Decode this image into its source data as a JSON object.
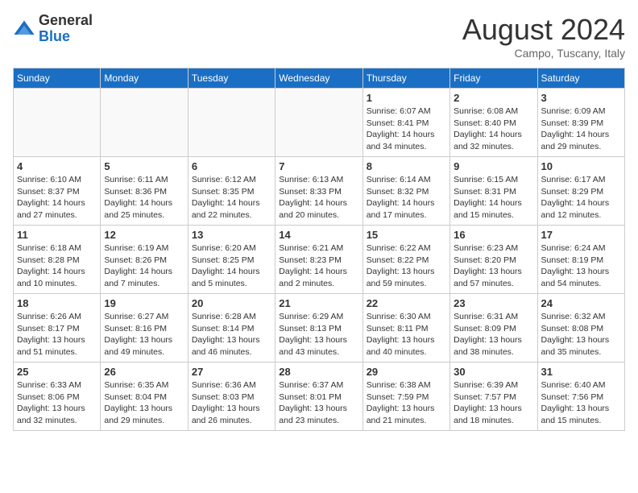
{
  "header": {
    "logo_general": "General",
    "logo_blue": "Blue",
    "month_year": "August 2024",
    "location": "Campo, Tuscany, Italy"
  },
  "weekdays": [
    "Sunday",
    "Monday",
    "Tuesday",
    "Wednesday",
    "Thursday",
    "Friday",
    "Saturday"
  ],
  "weeks": [
    [
      {
        "day": "",
        "info": ""
      },
      {
        "day": "",
        "info": ""
      },
      {
        "day": "",
        "info": ""
      },
      {
        "day": "",
        "info": ""
      },
      {
        "day": "1",
        "info": "Sunrise: 6:07 AM\nSunset: 8:41 PM\nDaylight: 14 hours\nand 34 minutes."
      },
      {
        "day": "2",
        "info": "Sunrise: 6:08 AM\nSunset: 8:40 PM\nDaylight: 14 hours\nand 32 minutes."
      },
      {
        "day": "3",
        "info": "Sunrise: 6:09 AM\nSunset: 8:39 PM\nDaylight: 14 hours\nand 29 minutes."
      }
    ],
    [
      {
        "day": "4",
        "info": "Sunrise: 6:10 AM\nSunset: 8:37 PM\nDaylight: 14 hours\nand 27 minutes."
      },
      {
        "day": "5",
        "info": "Sunrise: 6:11 AM\nSunset: 8:36 PM\nDaylight: 14 hours\nand 25 minutes."
      },
      {
        "day": "6",
        "info": "Sunrise: 6:12 AM\nSunset: 8:35 PM\nDaylight: 14 hours\nand 22 minutes."
      },
      {
        "day": "7",
        "info": "Sunrise: 6:13 AM\nSunset: 8:33 PM\nDaylight: 14 hours\nand 20 minutes."
      },
      {
        "day": "8",
        "info": "Sunrise: 6:14 AM\nSunset: 8:32 PM\nDaylight: 14 hours\nand 17 minutes."
      },
      {
        "day": "9",
        "info": "Sunrise: 6:15 AM\nSunset: 8:31 PM\nDaylight: 14 hours\nand 15 minutes."
      },
      {
        "day": "10",
        "info": "Sunrise: 6:17 AM\nSunset: 8:29 PM\nDaylight: 14 hours\nand 12 minutes."
      }
    ],
    [
      {
        "day": "11",
        "info": "Sunrise: 6:18 AM\nSunset: 8:28 PM\nDaylight: 14 hours\nand 10 minutes."
      },
      {
        "day": "12",
        "info": "Sunrise: 6:19 AM\nSunset: 8:26 PM\nDaylight: 14 hours\nand 7 minutes."
      },
      {
        "day": "13",
        "info": "Sunrise: 6:20 AM\nSunset: 8:25 PM\nDaylight: 14 hours\nand 5 minutes."
      },
      {
        "day": "14",
        "info": "Sunrise: 6:21 AM\nSunset: 8:23 PM\nDaylight: 14 hours\nand 2 minutes."
      },
      {
        "day": "15",
        "info": "Sunrise: 6:22 AM\nSunset: 8:22 PM\nDaylight: 13 hours\nand 59 minutes."
      },
      {
        "day": "16",
        "info": "Sunrise: 6:23 AM\nSunset: 8:20 PM\nDaylight: 13 hours\nand 57 minutes."
      },
      {
        "day": "17",
        "info": "Sunrise: 6:24 AM\nSunset: 8:19 PM\nDaylight: 13 hours\nand 54 minutes."
      }
    ],
    [
      {
        "day": "18",
        "info": "Sunrise: 6:26 AM\nSunset: 8:17 PM\nDaylight: 13 hours\nand 51 minutes."
      },
      {
        "day": "19",
        "info": "Sunrise: 6:27 AM\nSunset: 8:16 PM\nDaylight: 13 hours\nand 49 minutes."
      },
      {
        "day": "20",
        "info": "Sunrise: 6:28 AM\nSunset: 8:14 PM\nDaylight: 13 hours\nand 46 minutes."
      },
      {
        "day": "21",
        "info": "Sunrise: 6:29 AM\nSunset: 8:13 PM\nDaylight: 13 hours\nand 43 minutes."
      },
      {
        "day": "22",
        "info": "Sunrise: 6:30 AM\nSunset: 8:11 PM\nDaylight: 13 hours\nand 40 minutes."
      },
      {
        "day": "23",
        "info": "Sunrise: 6:31 AM\nSunset: 8:09 PM\nDaylight: 13 hours\nand 38 minutes."
      },
      {
        "day": "24",
        "info": "Sunrise: 6:32 AM\nSunset: 8:08 PM\nDaylight: 13 hours\nand 35 minutes."
      }
    ],
    [
      {
        "day": "25",
        "info": "Sunrise: 6:33 AM\nSunset: 8:06 PM\nDaylight: 13 hours\nand 32 minutes."
      },
      {
        "day": "26",
        "info": "Sunrise: 6:35 AM\nSunset: 8:04 PM\nDaylight: 13 hours\nand 29 minutes."
      },
      {
        "day": "27",
        "info": "Sunrise: 6:36 AM\nSunset: 8:03 PM\nDaylight: 13 hours\nand 26 minutes."
      },
      {
        "day": "28",
        "info": "Sunrise: 6:37 AM\nSunset: 8:01 PM\nDaylight: 13 hours\nand 23 minutes."
      },
      {
        "day": "29",
        "info": "Sunrise: 6:38 AM\nSunset: 7:59 PM\nDaylight: 13 hours\nand 21 minutes."
      },
      {
        "day": "30",
        "info": "Sunrise: 6:39 AM\nSunset: 7:57 PM\nDaylight: 13 hours\nand 18 minutes."
      },
      {
        "day": "31",
        "info": "Sunrise: 6:40 AM\nSunset: 7:56 PM\nDaylight: 13 hours\nand 15 minutes."
      }
    ]
  ]
}
